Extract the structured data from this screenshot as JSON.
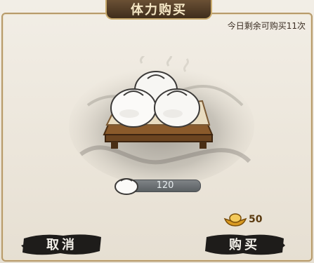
{
  "dialog": {
    "title": "体力购买",
    "remaining_text": "今日剩余可购买11次"
  },
  "item": {
    "icon": "steamed-bun-icon",
    "quantity": "120"
  },
  "price": {
    "icon": "gold-ingot-icon",
    "value": "50"
  },
  "buttons": {
    "cancel_label": "取消",
    "buy_label": "购买"
  },
  "colors": {
    "title_bg": "#3f2d1c",
    "title_text": "#f4e6c4",
    "button_ink": "#1e1c1a",
    "gold": "#e8b84a"
  }
}
